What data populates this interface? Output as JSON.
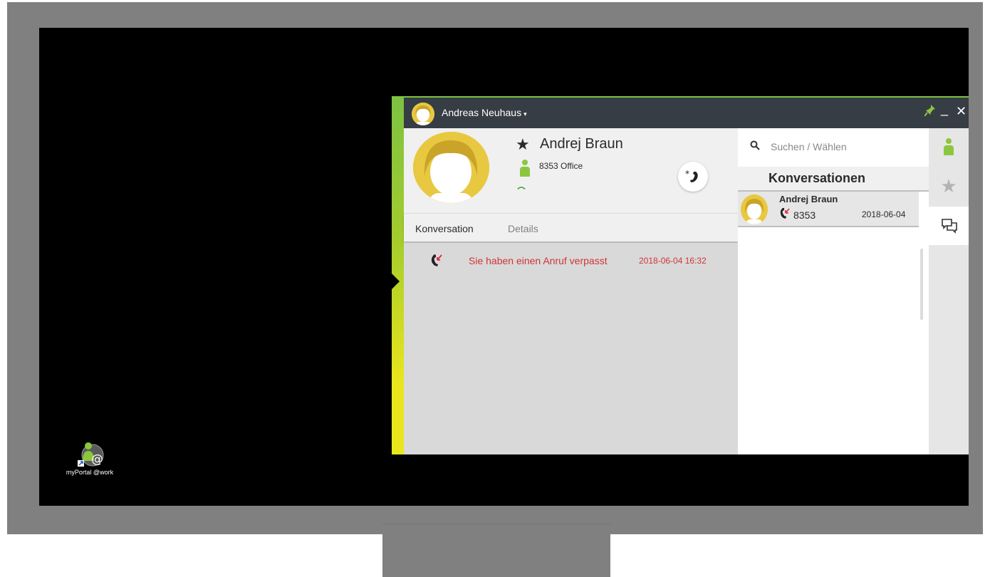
{
  "desktop": {
    "icon_label": "myPortal @work"
  },
  "window": {
    "user_name": "Andreas Neuhaus",
    "user_menu_chevron": "▾",
    "pin_icon": "pin-icon",
    "minimize_label": "_",
    "close_label": "✕"
  },
  "contact": {
    "name": "Andrej Braun",
    "favorite_icon": "★",
    "line": "8353 Office",
    "presence_color": "#8cc63f",
    "phone_icon": "☎",
    "call_icon": "*☎"
  },
  "tabs": [
    {
      "label": "Konversation",
      "active": true
    },
    {
      "label": "Details",
      "active": false
    }
  ],
  "history": [
    {
      "text": "Sie haben einen Anruf verpasst",
      "time": "2018-06-04 16:32",
      "color": "#d0343a"
    }
  ],
  "search": {
    "placeholder": "Suchen / Wählen",
    "icon": "🔍"
  },
  "conversations": {
    "title": "Konversationen",
    "items": [
      {
        "name": "Andrej Braun",
        "number": "8353",
        "date": "2018-06-04"
      }
    ]
  },
  "nav": {
    "favorites_icon": "★"
  },
  "colors": {
    "accent_green": "#7dc242",
    "accent_yellow": "#e9e61c",
    "titlebar": "#363d44",
    "missed_red": "#d0343a",
    "avatar_yellow": "#e8c840"
  }
}
